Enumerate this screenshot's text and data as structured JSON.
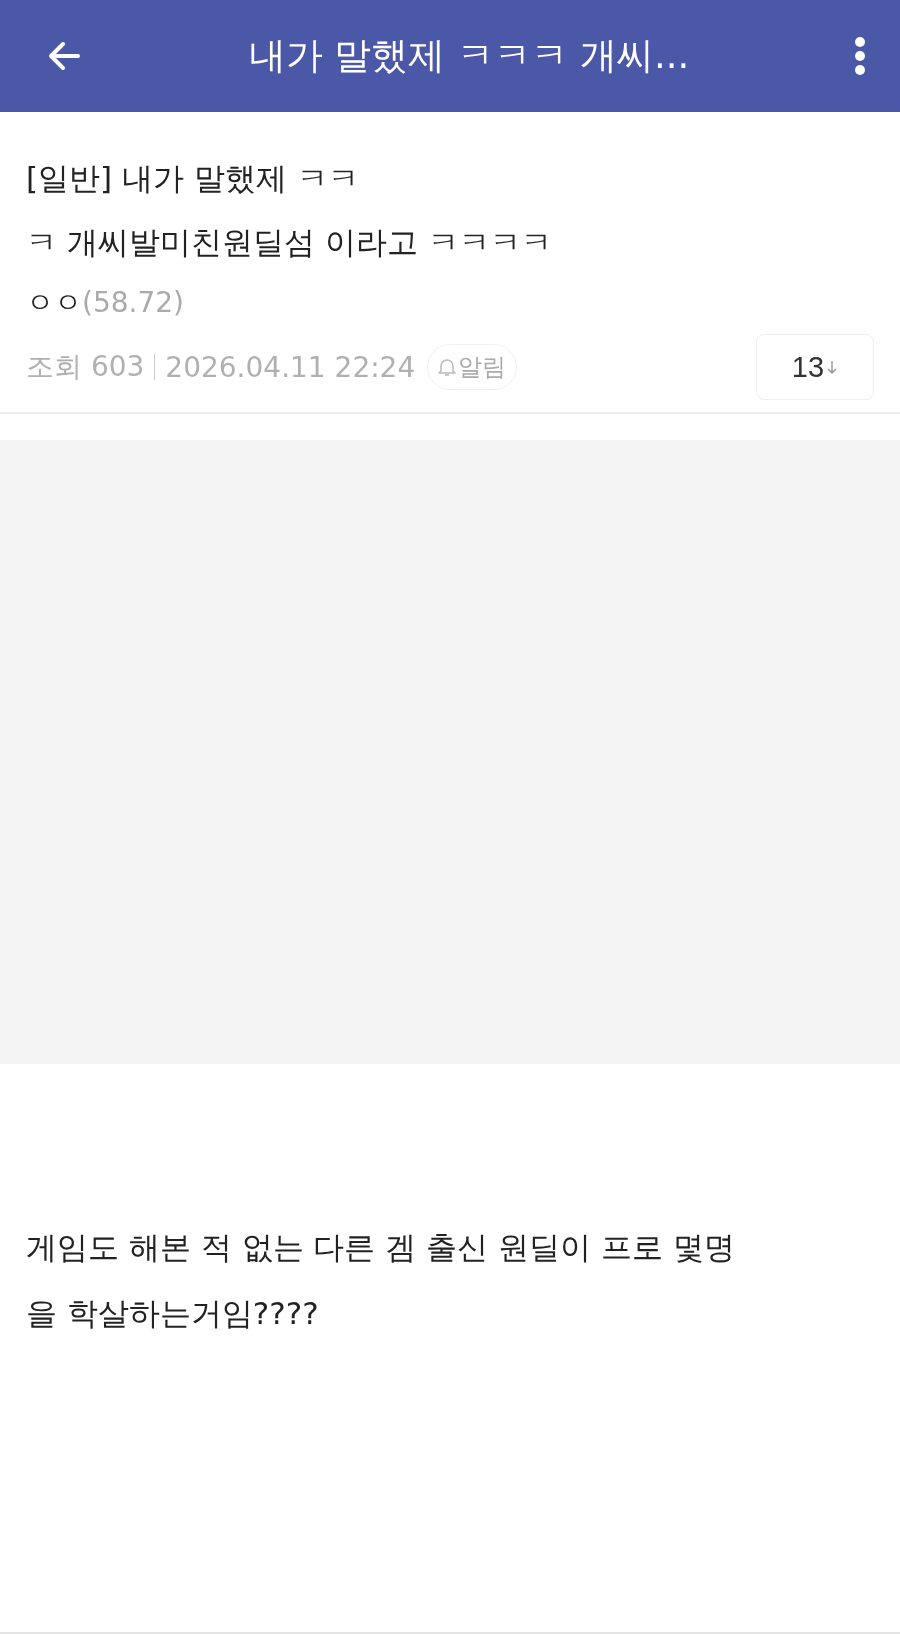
{
  "app_bar": {
    "title": "내가 말했제 ㅋㅋㅋ 개씨..."
  },
  "post": {
    "title_lines": [
      "[일반] 내가 말했제 ㅋㅋ",
      "ㅋ 개씨발미친원딜섬 이라고 ㅋㅋㅋㅋ"
    ],
    "author": "ㅇㅇ",
    "author_ip": "(58.72)",
    "views": "조회 603",
    "date": "2026.04.11 22:24",
    "alert_label": "알림",
    "comment_count": "13",
    "body_lines": [
      "게임도 해본 적 없는 다른 겜 출신 원딜이 프로 몇명",
      "을 학살하는거임????"
    ]
  }
}
